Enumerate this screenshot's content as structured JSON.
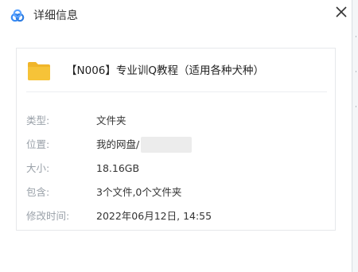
{
  "window": {
    "title": "详细信息",
    "close_glyph": "✕"
  },
  "file": {
    "name": "【N006】专业训Q教程（适用各种犬种）"
  },
  "details": [
    {
      "label": "类型:",
      "value": "文件夹"
    },
    {
      "label": "位置:",
      "value": "我的网盘/"
    },
    {
      "label": "大小:",
      "value": "18.16GB"
    },
    {
      "label": "包含:",
      "value": "3个文件,0个文件夹"
    },
    {
      "label": "修改时间:",
      "value": "2022年06月12日, 14:55"
    }
  ],
  "colors": {
    "accent": "#3a8cf5",
    "folder": "#f6c338",
    "label": "#9aa1a9"
  },
  "icons": {
    "logo": "cloud-logo-icon",
    "close": "close-icon",
    "folder": "folder-icon"
  }
}
